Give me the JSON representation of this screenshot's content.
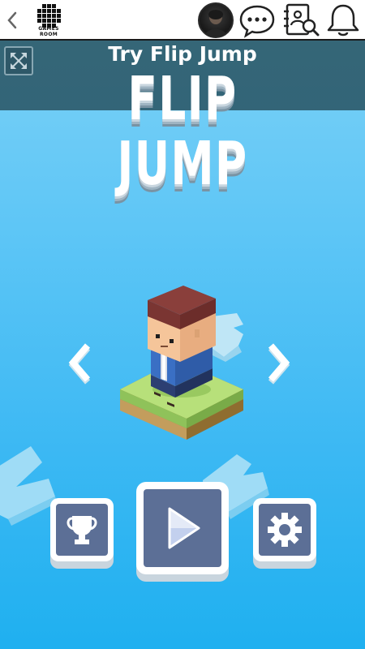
{
  "topbar": {
    "back_icon": "chevron-left-icon",
    "logo_text": "GAMES ROOM",
    "avatar": "user-avatar",
    "icons": [
      "chat-bubble-icon",
      "contacts-search-icon",
      "bell-icon"
    ]
  },
  "header": {
    "title": "Try Flip Jump",
    "fullscreen_icon": "expand-icon"
  },
  "game": {
    "logo_line1": "FLIP",
    "logo_line2": "JUMP",
    "prev_icon": "chevron-left-icon",
    "next_icon": "chevron-right-icon",
    "buttons": {
      "leaderboard_icon": "trophy-icon",
      "play_icon": "play-icon",
      "settings_icon": "gear-icon"
    }
  },
  "colors": {
    "sky_top": "#7fd2f5",
    "sky_bottom": "#1fb0f0",
    "header_overlay": "#264e5c",
    "button_fill": "#5c6f96",
    "island_grass": "#aede6e",
    "island_dirt": "#c8a46a"
  }
}
